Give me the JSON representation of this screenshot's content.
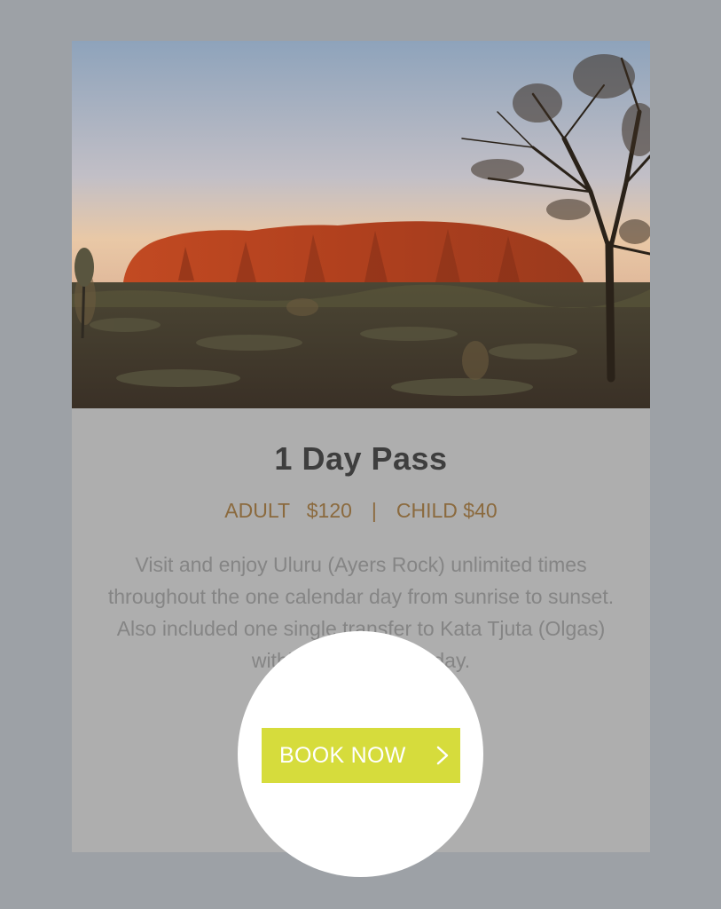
{
  "card": {
    "image": {
      "subject": "uluru-at-sunset-photo",
      "colors": {
        "sky_top": "#8ea3bb",
        "sky_bottom": "#e9c8a6",
        "rock": "#b0401e",
        "ground": "#3f3a2c"
      }
    },
    "title": "1 Day Pass",
    "prices": {
      "adult": "ADULT   $120",
      "separator": "|",
      "child": "CHILD $40"
    },
    "description": "Visit and enjoy Uluru (Ayers Rock) unlimited times throughout the one calendar day from sunrise to sunset. Also included one single transfer to Kata Tjuta (Olgas) within that calendar day.",
    "book_button": {
      "label": "BOOK NOW",
      "icon": "chevron-right-icon"
    }
  },
  "colors": {
    "page_background": "#9da1a6",
    "card_background": "#aeaeae",
    "title": "#3e3e3e",
    "prices": "#8b6a3e",
    "description": "#858585",
    "button": "#d6dc3c",
    "spotlight": "#ffffff"
  }
}
